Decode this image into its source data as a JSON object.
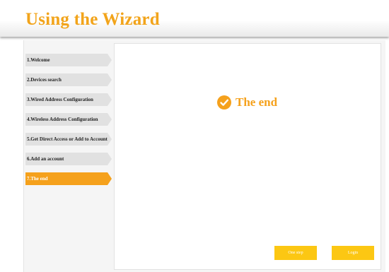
{
  "header": {
    "title": "Using the Wizard"
  },
  "sidebar": {
    "steps": [
      {
        "label": "1.Welcome"
      },
      {
        "label": "2.Devices search"
      },
      {
        "label": "3.Wired Address Configuration"
      },
      {
        "label": "4.Wireless Address Configuration"
      },
      {
        "label": "5.Get Direct Access or Add to Account"
      },
      {
        "label": "6.Add an account"
      },
      {
        "label": "7.The end"
      }
    ],
    "active_index": 6
  },
  "main": {
    "heading": "The end",
    "heading_icon": "check-circle-icon",
    "buttons": {
      "one_step": "One step",
      "login": "Login"
    }
  },
  "colors": {
    "accent": "#f5a11c",
    "title": "#f2a41b",
    "button": "#fcc713",
    "step_bg": "#e1e1e1"
  }
}
